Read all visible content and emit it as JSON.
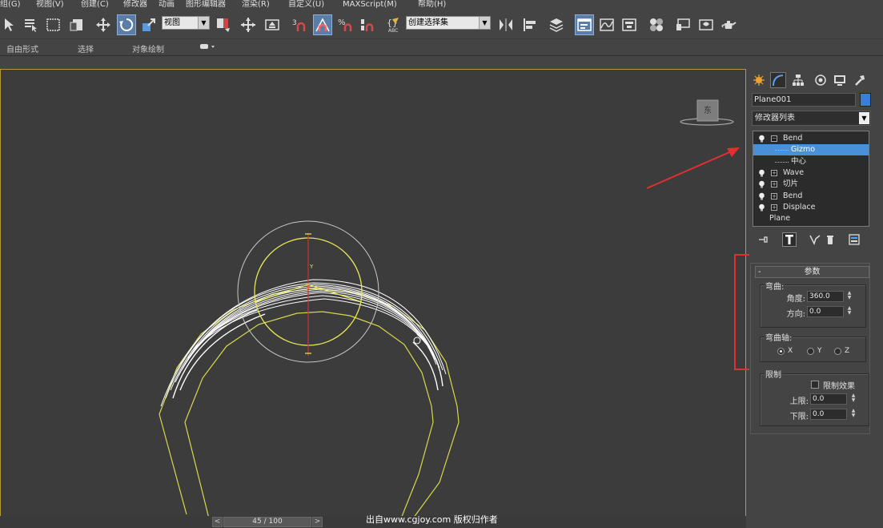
{
  "menu": [
    "组(G)",
    "视图(V)",
    "创建(C)",
    "修改器",
    "动画",
    "图形编辑器",
    "渲染(R)",
    "自定义(U)",
    "MAXScript(M)",
    "帮助(H)"
  ],
  "toolbar": {
    "view_select": "视图",
    "selection_set": "创建选择集"
  },
  "ribbon": [
    "自由形式",
    "选择",
    "对象绘制"
  ],
  "viewport": {
    "viewcube_label": "东",
    "gizmo_axis_label": "Y"
  },
  "timeline": {
    "prev": "<",
    "position": "45 / 100",
    "next": ">"
  },
  "watermark": "出自www.cgjoy.com 版权归作者",
  "panel": {
    "object_name": "Plane001",
    "object_color": "#3b7ed8",
    "modifier_list": "修改器列表",
    "stack": [
      {
        "label": "Bend",
        "level": 0,
        "bulb": true,
        "box": "−",
        "selected": false
      },
      {
        "label": "Gizmo",
        "level": 1,
        "bulb": false,
        "box": "",
        "selected": true
      },
      {
        "label": "中心",
        "level": 1,
        "bulb": false,
        "box": "",
        "selected": false
      },
      {
        "label": "Wave",
        "level": 0,
        "bulb": true,
        "box": "+",
        "selected": false
      },
      {
        "label": "切片",
        "level": 0,
        "bulb": true,
        "box": "+",
        "selected": false
      },
      {
        "label": "Bend",
        "level": 0,
        "bulb": true,
        "box": "+",
        "selected": false
      },
      {
        "label": "Displace",
        "level": 0,
        "bulb": true,
        "box": "+",
        "selected": false
      },
      {
        "label": "Plane",
        "level": 0,
        "bulb": false,
        "box": "",
        "selected": false
      }
    ],
    "params": {
      "header": "参数",
      "collapse": "-",
      "bend_group": "弯曲:",
      "angle_label": "角度:",
      "angle_value": "360.0",
      "direction_label": "方向:",
      "direction_value": "0.0",
      "axis_group": "弯曲轴:",
      "axes": [
        {
          "label": "X",
          "selected": true
        },
        {
          "label": "Y",
          "selected": false
        },
        {
          "label": "Z",
          "selected": false
        }
      ],
      "limits_group": "限制",
      "limit_effect_label": "限制效果",
      "limit_effect_checked": false,
      "upper_label": "上限:",
      "upper_value": "0.0",
      "lower_label": "下限:",
      "lower_value": "0.0"
    }
  },
  "annotation_color": "#e03030"
}
